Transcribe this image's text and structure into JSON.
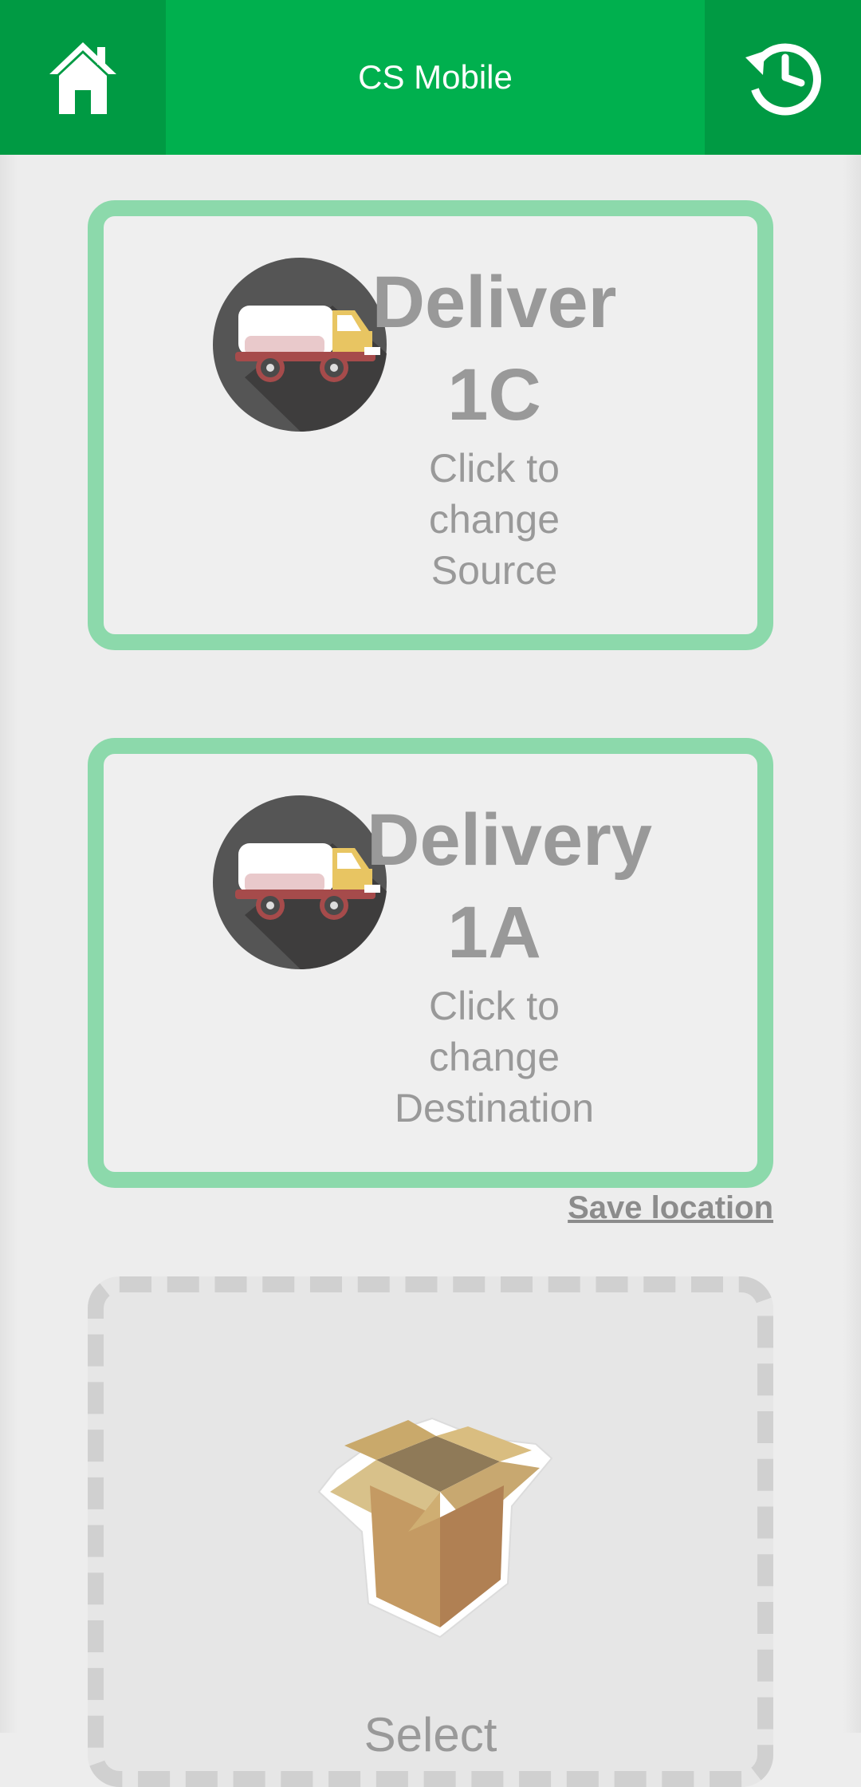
{
  "header": {
    "title": "CS Mobile",
    "home_icon": "home-icon",
    "history_icon": "history-icon"
  },
  "source_card": {
    "heading_line1": "Deliver",
    "heading_line2": "1C",
    "sub_line1": "Click to",
    "sub_line2": "change",
    "sub_line3": "Source",
    "icon": "delivery-truck-icon"
  },
  "destination_card": {
    "heading_line1": "Delivery",
    "heading_line2": "1A",
    "sub_line1": "Click to",
    "sub_line2": "change",
    "sub_line3": "Destination",
    "icon": "delivery-truck-icon"
  },
  "save_location_label": "Save location",
  "item_select": {
    "label": "Select",
    "icon": "open-box-icon"
  },
  "colors": {
    "header_green": "#00b04e",
    "header_side_green": "#009a43",
    "card_border": "#8cd9ab",
    "text_gray": "#999999"
  }
}
